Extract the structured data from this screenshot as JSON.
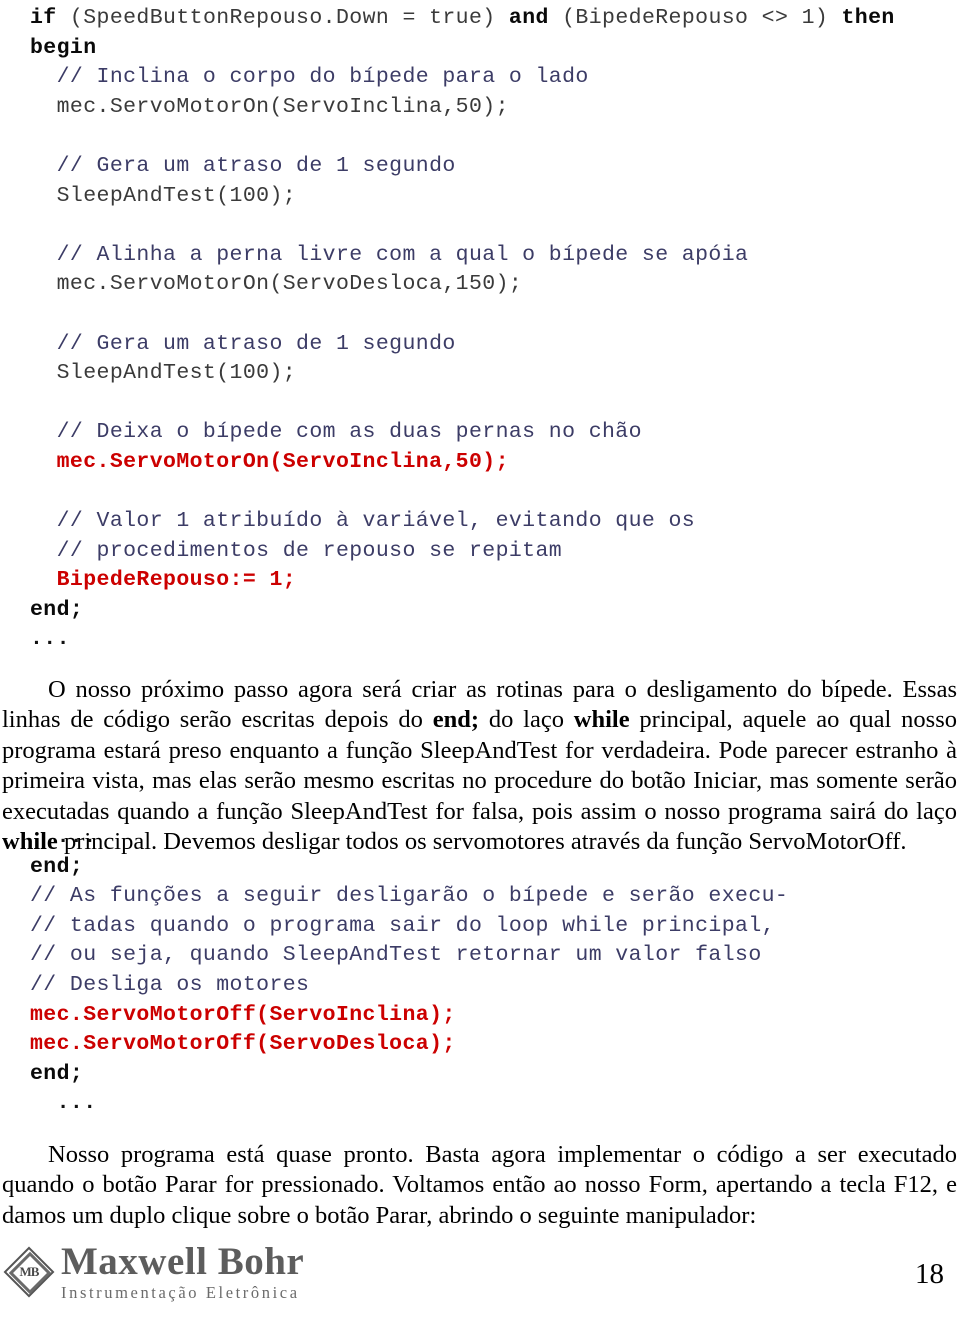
{
  "document": {
    "page_number": "18",
    "colors": {
      "comment": "#3c3c66",
      "highlight_code": "#cc0000",
      "plain_code": "#3a3a3a",
      "keyword": "#0a0a0a",
      "body_text": "#000000",
      "logo": "#5d5d5d"
    }
  },
  "code_block_1": {
    "lines": [
      {
        "id": "l1",
        "indent": 0,
        "segments": [
          {
            "style": "keyword",
            "text": "if "
          },
          {
            "style": "plain",
            "text": "(SpeedButtonRepouso.Down = true) "
          },
          {
            "style": "keyword",
            "text": "and "
          },
          {
            "style": "plain",
            "text": "(BipedeRepouso <> 1) "
          },
          {
            "style": "keyword",
            "text": "then"
          }
        ]
      },
      {
        "id": "l2",
        "indent": 0,
        "segments": [
          {
            "style": "keyword",
            "text": "begin"
          }
        ]
      },
      {
        "id": "l3",
        "indent": 1,
        "segments": [
          {
            "style": "comment",
            "text": "// Inclina o corpo do bípede para o lado"
          }
        ]
      },
      {
        "id": "l4",
        "indent": 1,
        "segments": [
          {
            "style": "plain",
            "text": "mec.ServoMotorOn(ServoInclina,50);"
          }
        ]
      },
      {
        "id": "l5",
        "indent": 0,
        "segments": []
      },
      {
        "id": "l6",
        "indent": 1,
        "segments": [
          {
            "style": "comment",
            "text": "// Gera um atraso de 1 segundo"
          }
        ]
      },
      {
        "id": "l7",
        "indent": 1,
        "segments": [
          {
            "style": "plain",
            "text": "SleepAndTest(100);"
          }
        ]
      },
      {
        "id": "l8",
        "indent": 0,
        "segments": []
      },
      {
        "id": "l9",
        "indent": 1,
        "segments": [
          {
            "style": "comment",
            "text": "// Alinha a perna livre com a qual o bípede se apóia"
          }
        ]
      },
      {
        "id": "l10",
        "indent": 1,
        "segments": [
          {
            "style": "plain",
            "text": "mec.ServoMotorOn(ServoDesloca,150);"
          }
        ]
      },
      {
        "id": "l11",
        "indent": 0,
        "segments": []
      },
      {
        "id": "l12",
        "indent": 1,
        "segments": [
          {
            "style": "comment",
            "text": "// Gera um atraso de 1 segundo"
          }
        ]
      },
      {
        "id": "l13",
        "indent": 1,
        "segments": [
          {
            "style": "plain",
            "text": "SleepAndTest(100);"
          }
        ]
      },
      {
        "id": "l14",
        "indent": 0,
        "segments": []
      },
      {
        "id": "l15",
        "indent": 1,
        "segments": [
          {
            "style": "comment",
            "text": "// Deixa o bípede com as duas pernas no chão"
          }
        ]
      },
      {
        "id": "l16",
        "indent": 1,
        "segments": [
          {
            "style": "red",
            "text": "mec.ServoMotorOn(ServoInclina,50);"
          }
        ]
      },
      {
        "id": "l17",
        "indent": 0,
        "segments": []
      },
      {
        "id": "l18",
        "indent": 1,
        "segments": [
          {
            "style": "comment",
            "text": "// Valor 1 atribuído à variável, evitando que os"
          }
        ]
      },
      {
        "id": "l19",
        "indent": 1,
        "segments": [
          {
            "style": "comment",
            "text": "// procedimentos de repouso se repitam"
          }
        ]
      },
      {
        "id": "l20",
        "indent": 1,
        "segments": [
          {
            "style": "red",
            "text": "BipedeRepouso:= 1;"
          }
        ]
      },
      {
        "id": "l21",
        "indent": 0,
        "segments": [
          {
            "style": "keyword",
            "text": "end;"
          }
        ]
      },
      {
        "id": "l22",
        "indent": 0,
        "segments": [
          {
            "style": "dots",
            "text": "..."
          }
        ]
      }
    ]
  },
  "paragraph_1": {
    "runs": [
      {
        "style": "normal",
        "text": "O nosso próximo passo agora será criar as rotinas para o desligamento do bípede. Essas linhas de código serão escritas depois do "
      },
      {
        "style": "bold",
        "text": "end;"
      },
      {
        "style": "normal",
        "text": " do laço "
      },
      {
        "style": "bold",
        "text": "while"
      },
      {
        "style": "normal",
        "text": " principal, aquele ao qual nosso programa estará preso enquanto a função SleepAndTest for verdadeira. Pode parecer estranho à primeira vista, mas elas serão mesmo escritas no procedure do botão Iniciar, mas somente serão executadas quando a função SleepAndTest for falsa, pois assim o nosso programa sairá do laço "
      },
      {
        "style": "bold",
        "text": "while"
      },
      {
        "style": "normal",
        "text": " principal. Devemos desligar todos os servomotores através da função ServoMotorOff."
      }
    ]
  },
  "code_block_2": {
    "lines": [
      {
        "id": "m1",
        "indent": 1,
        "segments": [
          {
            "style": "dots",
            "text": "..."
          }
        ]
      },
      {
        "id": "m2",
        "indent": 0,
        "segments": [
          {
            "style": "keyword",
            "text": "end;"
          }
        ]
      },
      {
        "id": "m3",
        "indent": 0,
        "segments": [
          {
            "style": "comment",
            "text": "// As funções a seguir desligarão o bípede e serão execu-"
          }
        ]
      },
      {
        "id": "m4",
        "indent": 0,
        "segments": [
          {
            "style": "comment",
            "text": "// tadas quando o programa sair do loop while principal,"
          }
        ]
      },
      {
        "id": "m5",
        "indent": 0,
        "segments": [
          {
            "style": "comment",
            "text": "// ou seja, quando SleepAndTest retornar um valor falso"
          }
        ]
      },
      {
        "id": "m6",
        "indent": 0,
        "segments": [
          {
            "style": "comment",
            "text": "// Desliga os motores"
          }
        ]
      },
      {
        "id": "m7",
        "indent": 0,
        "segments": [
          {
            "style": "red",
            "text": "mec.ServoMotorOff(ServoInclina);"
          }
        ]
      },
      {
        "id": "m8",
        "indent": 0,
        "segments": [
          {
            "style": "red",
            "text": "mec.ServoMotorOff(ServoDesloca);"
          }
        ]
      },
      {
        "id": "m9",
        "indent": 0,
        "segments": [
          {
            "style": "keyword",
            "text": "end;"
          }
        ]
      },
      {
        "id": "m10",
        "indent": 1,
        "segments": [
          {
            "style": "dots",
            "text": "..."
          }
        ]
      }
    ]
  },
  "paragraph_2": {
    "runs": [
      {
        "style": "normal",
        "text": "Nosso programa está quase pronto. Basta agora implementar o código a ser executado quando o botão Parar for pressionado. Voltamos então ao nosso Form, apertando a tecla F12, e damos um duplo clique sobre o botão Parar, abrindo o seguinte manipulador:"
      }
    ]
  },
  "footer": {
    "logo_monogram": "MB",
    "logo_name": "Maxwell Bohr",
    "logo_subtitle": "Instrumentação Eletrônica",
    "page_number": "18"
  }
}
